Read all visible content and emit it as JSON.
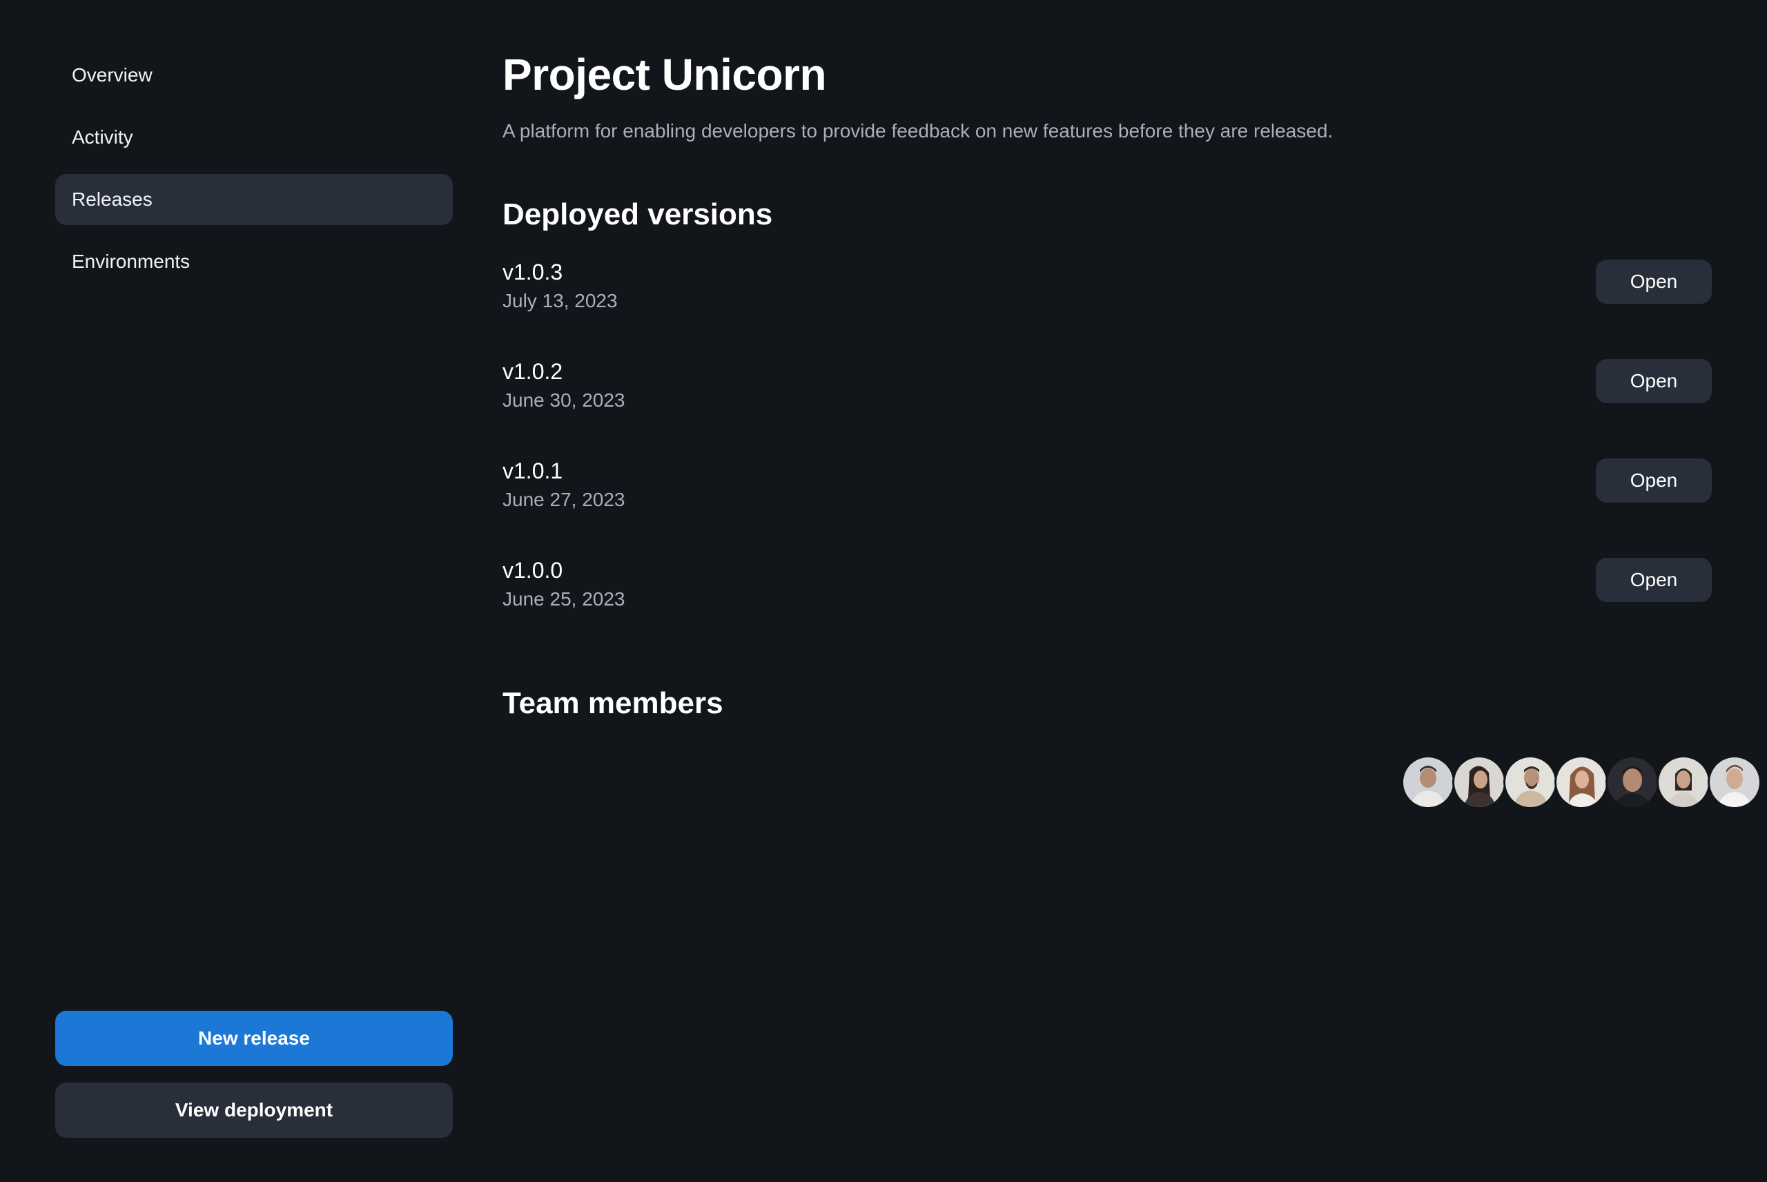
{
  "sidebar": {
    "items": [
      {
        "label": "Overview",
        "active": false
      },
      {
        "label": "Activity",
        "active": false
      },
      {
        "label": "Releases",
        "active": true
      },
      {
        "label": "Environments",
        "active": false
      }
    ],
    "new_release_label": "New release",
    "view_deployment_label": "View deployment"
  },
  "main": {
    "title": "Project Unicorn",
    "description": "A platform for enabling developers to provide feedback on new features before they are released.",
    "deployed_title": "Deployed versions",
    "versions": [
      {
        "name": "v1.0.3",
        "date": "July 13, 2023",
        "action": "Open"
      },
      {
        "name": "v1.0.2",
        "date": "June 30, 2023",
        "action": "Open"
      },
      {
        "name": "v1.0.1",
        "date": "June 27, 2023",
        "action": "Open"
      },
      {
        "name": "v1.0.0",
        "date": "June 25, 2023",
        "action": "Open"
      }
    ],
    "team_title": "Team members",
    "team_member_count": 7
  },
  "colors": {
    "background": "#12151a",
    "surface": "#282f3a",
    "primary": "#1c78d6",
    "muted_text": "#a8b0bd"
  }
}
